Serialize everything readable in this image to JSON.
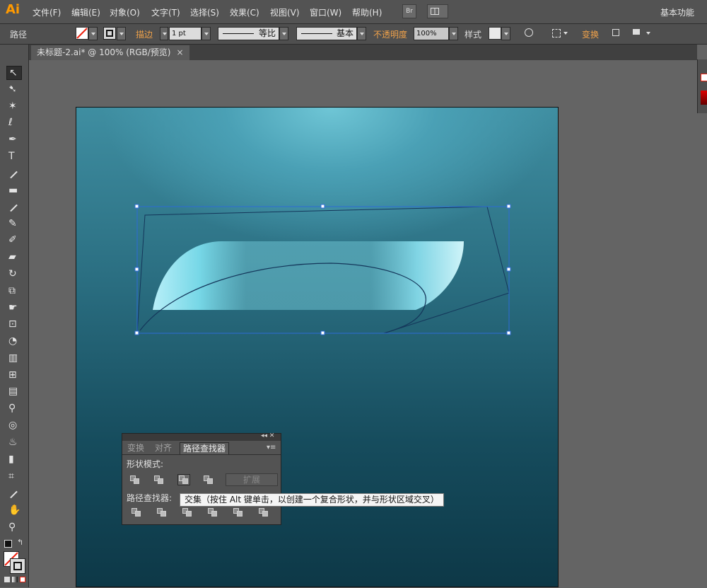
{
  "app": {
    "logo": "Ai"
  },
  "menu": [
    "文件(F)",
    "编辑(E)",
    "对象(O)",
    "文字(T)",
    "选择(S)",
    "效果(C)",
    "视图(V)",
    "窗口(W)",
    "帮助(H)"
  ],
  "menubar_button": "Br",
  "workspace": "基本功能",
  "control_bar": {
    "selection_label": "路径",
    "stroke_label": "描边",
    "stroke_weight": "1 pt",
    "profile_label": "等比",
    "brush_label": "基本",
    "opacity_label": "不透明度",
    "opacity_value": "100%",
    "style_label": "样式",
    "transform_label": "变换"
  },
  "document_tab": {
    "title": "未标题-2.ai* @ 100% (RGB/预览)",
    "close": "×"
  },
  "pathfinder_panel": {
    "tabs": [
      "变换",
      "对齐",
      "路径查找器"
    ],
    "active_tab": "路径查找器",
    "shape_modes_label": "形状模式:",
    "pathfinders_label": "路径查找器:",
    "expand_label": "扩展",
    "header_controls": "◂◂ ✕",
    "menu_icon": "▾≡"
  },
  "tooltip": "交集（按住 Alt 键单击，以创建一个复合形状，并与形状区域交叉）",
  "colors": {
    "accent_orange": "#f0a24a",
    "selection_blue": "#2d6bd6",
    "artboard_top": "#6fc6d6",
    "artboard_bottom": "#0d3847"
  },
  "tools": [
    "selection-icon",
    "direct-selection-icon",
    "magic-wand-icon",
    "lasso-icon",
    "pen-icon",
    "type-icon",
    "line-icon",
    "rectangle-icon",
    "paintbrush-icon",
    "pencil-icon",
    "blob-brush-icon",
    "eraser-icon",
    "rotate-icon",
    "scale-icon",
    "warp-icon",
    "free-transform-icon",
    "shape-builder-icon",
    "perspective-grid-icon",
    "mesh-icon",
    "gradient-icon",
    "eyedropper-icon",
    "blend-icon",
    "symbol-sprayer-icon",
    "column-graph-icon",
    "artboard-icon",
    "slice-icon",
    "hand-icon",
    "zoom-icon"
  ]
}
